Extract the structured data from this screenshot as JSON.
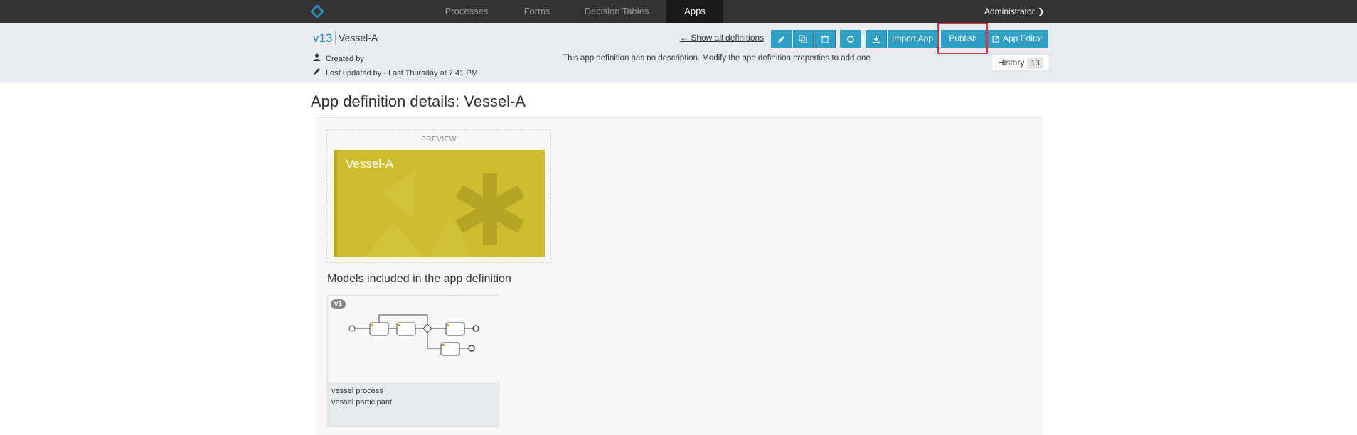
{
  "nav": {
    "items": [
      "Processes",
      "Forms",
      "Decision Tables",
      "Apps"
    ],
    "active": "Apps",
    "user": "Administrator",
    "user_icon": "chevron-down-icon"
  },
  "header": {
    "version": "v13",
    "app_name": "Vessel-A",
    "created_by": "Created by",
    "last_updated": "Last updated by - Last Thursday at 7:41 PM",
    "show_all": "← Show all definitions",
    "description": "This app definition has no description. Modify the app definition properties to add one",
    "buttons": {
      "import": "Import App",
      "publish": "Publish",
      "app_editor": "App Editor"
    },
    "history_label": "History",
    "history_count": "13"
  },
  "main": {
    "title": "App definition details: Vessel-A",
    "preview_label": "PREVIEW",
    "tile_title": "Vessel-A",
    "tile_color": "#cebc2e",
    "models_heading": "Models included in the app definition",
    "model": {
      "version": "v1",
      "lines": [
        "vessel process",
        "vessel participant"
      ]
    }
  },
  "colors": {
    "accent": "#2fa0c4",
    "nav_bg": "#333333",
    "highlight": "#e0323e"
  }
}
